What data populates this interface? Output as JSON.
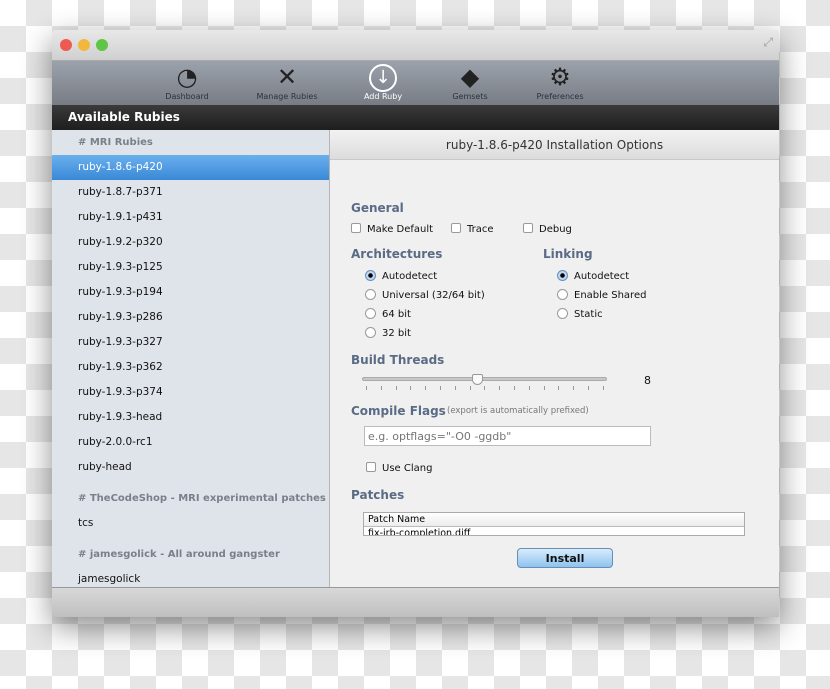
{
  "window": {
    "traffic_lights": [
      "#ee5a52",
      "#f4b73d",
      "#5fc546"
    ]
  },
  "toolbar": {
    "items": [
      {
        "label": "Dashboard",
        "icon": "dashboard-gauge-icon",
        "glyph": "◔"
      },
      {
        "label": "Manage Rubies",
        "icon": "wrench-screwdriver-icon",
        "glyph": "✕"
      },
      {
        "label": "Add Ruby",
        "icon": "download-arrow-icon",
        "glyph": "↓"
      },
      {
        "label": "Gemsets",
        "icon": "gem-icon",
        "glyph": "◆"
      },
      {
        "label": "Preferences",
        "icon": "gear-icon",
        "glyph": "⚙"
      }
    ],
    "active": "Add Ruby"
  },
  "sidebar": {
    "title": "Available Rubies",
    "groups": [
      {
        "header": "# MRI Rubies",
        "items": [
          "ruby-1.8.6-p420",
          "ruby-1.8.7-p371",
          "ruby-1.9.1-p431",
          "ruby-1.9.2-p320",
          "ruby-1.9.3-p125",
          "ruby-1.9.3-p194",
          "ruby-1.9.3-p286",
          "ruby-1.9.3-p327",
          "ruby-1.9.3-p362",
          "ruby-1.9.3-p374",
          "ruby-1.9.3-head",
          "ruby-2.0.0-rc1",
          "ruby-head"
        ]
      },
      {
        "header": "# TheCodeShop - MRI experimental patches",
        "items": [
          "tcs"
        ]
      },
      {
        "header": "# jamesgolick - All around gangster",
        "items": [
          "jamesgolick"
        ]
      }
    ],
    "selected": "ruby-1.8.6-p420"
  },
  "main": {
    "title": "ruby-1.8.6-p420 Installation Options",
    "general": {
      "label": "General",
      "options": [
        {
          "label": "Make Default",
          "checked": false
        },
        {
          "label": "Trace",
          "checked": false
        },
        {
          "label": "Debug",
          "checked": false
        }
      ]
    },
    "architectures": {
      "label": "Architectures",
      "options": [
        "Autodetect",
        "Universal (32/64 bit)",
        "64 bit",
        "32 bit"
      ],
      "selected": "Autodetect"
    },
    "linking": {
      "label": "Linking",
      "options": [
        "Autodetect",
        "Enable Shared",
        "Static"
      ],
      "selected": "Autodetect"
    },
    "build_threads": {
      "label": "Build Threads",
      "value": "8",
      "slider_fraction": 0.47
    },
    "compile_flags": {
      "label": "Compile Flags",
      "note": "(export is automatically prefixed)",
      "placeholder": "e.g. optflags=\"-O0 -ggdb\"",
      "value": ""
    },
    "use_clang": {
      "label": "Use Clang",
      "checked": false
    },
    "patches": {
      "label": "Patches",
      "column": "Patch Name",
      "rows": [
        "fix-irb-completion.diff"
      ]
    },
    "install_label": "Install"
  }
}
